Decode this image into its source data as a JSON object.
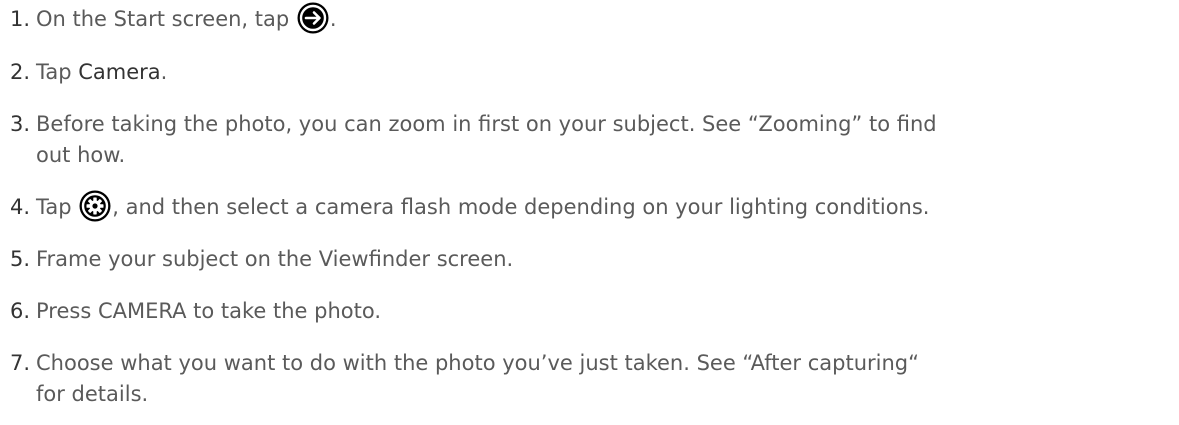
{
  "steps": [
    {
      "num": "1.",
      "before": "On the Start screen, tap ",
      "icon": "arrow-right-circle-icon",
      "after": "."
    },
    {
      "num": "2.",
      "before": "Tap ",
      "strong": "Camera",
      "after": "."
    },
    {
      "num": "3.",
      "line1": "Before taking the photo, you can zoom in first on your subject. See “Zooming” to find",
      "line2": "out how."
    },
    {
      "num": "4.",
      "before": "Tap ",
      "icon": "settings-gear-icon",
      "after": ", and then select a camera flash mode depending on your lighting conditions."
    },
    {
      "num": "5.",
      "text": "Frame your subject on the Viewfinder screen."
    },
    {
      "num": "6.",
      "text": "Press CAMERA to take the photo."
    },
    {
      "num": "7.",
      "line1": "Choose what you want to do with the photo you’ve just taken. See “After capturing“",
      "line2": "for details."
    }
  ]
}
